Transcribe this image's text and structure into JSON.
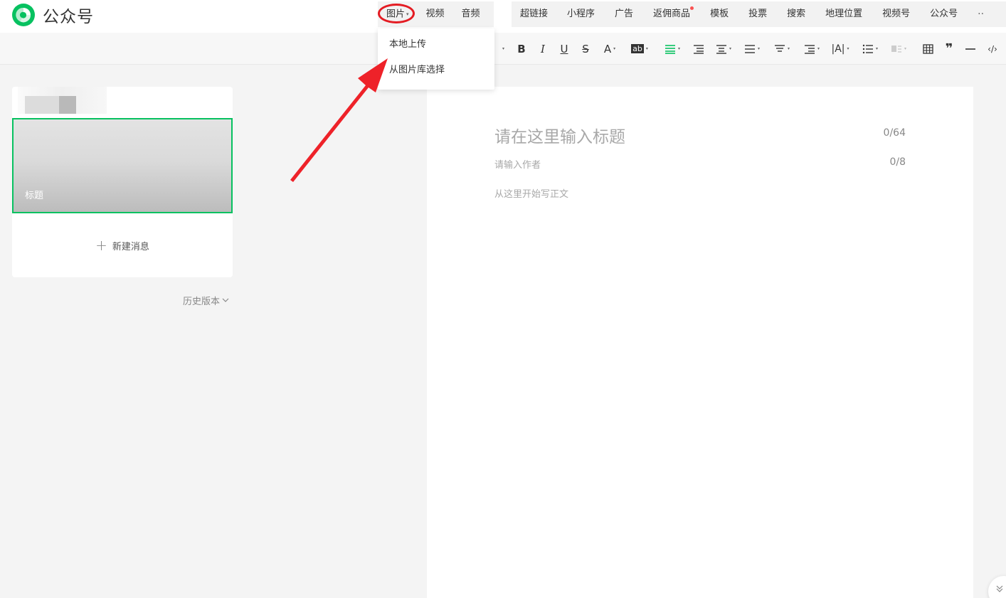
{
  "app": {
    "title": "公众号"
  },
  "media_tabs": [
    {
      "label": "图片"
    },
    {
      "label": "视频"
    },
    {
      "label": "音频"
    }
  ],
  "insert_tabs": [
    {
      "label": "超链接"
    },
    {
      "label": "小程序"
    },
    {
      "label": "广告"
    },
    {
      "label": "返佣商品"
    },
    {
      "label": "模板"
    },
    {
      "label": "投票"
    },
    {
      "label": "搜索"
    },
    {
      "label": "地理位置"
    },
    {
      "label": "视频号"
    },
    {
      "label": "公众号"
    }
  ],
  "image_dropdown": {
    "items": [
      {
        "label": "本地上传"
      },
      {
        "label": "从图片库选择"
      }
    ]
  },
  "toolbar": {
    "bold": "B",
    "italic": "I",
    "underline": "U",
    "strikethrough": "S",
    "font_color": "A",
    "highlight": "ab"
  },
  "article_list": {
    "first_title": "标题",
    "new_message": "新建消息",
    "history": "历史版本"
  },
  "editor": {
    "title_placeholder": "请在这里输入标题",
    "title_count": "0/64",
    "author_placeholder": "请输入作者",
    "author_count": "0/8",
    "body_placeholder": "从这里开始写正文"
  },
  "colors": {
    "brand_green": "#07c160",
    "annotation_red": "#e41c23",
    "notification_dot": "#fa5151"
  }
}
